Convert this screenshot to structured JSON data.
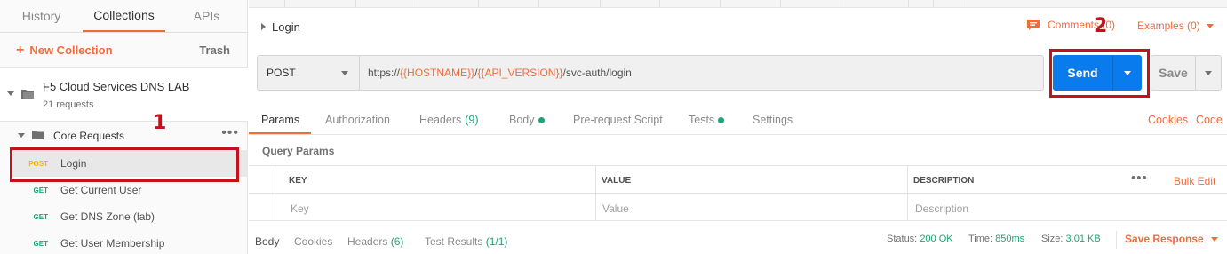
{
  "sidebar": {
    "tabs": [
      {
        "label": "History"
      },
      {
        "label": "Collections"
      },
      {
        "label": "APIs"
      }
    ],
    "new_collection": "New Collection",
    "trash": "Trash",
    "collection": {
      "title": "F5 Cloud Services DNS LAB",
      "subtitle": "21 requests"
    },
    "folder": {
      "label": "Core Requests"
    },
    "requests": [
      {
        "method": "POST",
        "name": "Login"
      },
      {
        "method": "GET",
        "name": "Get Current User"
      },
      {
        "method": "GET",
        "name": "Get DNS Zone (lab)"
      },
      {
        "method": "GET",
        "name": "Get User Membership"
      }
    ]
  },
  "annotations": {
    "one": "1",
    "two": "2"
  },
  "request": {
    "name": "Login",
    "comments": "Comments (0)",
    "examples": "Examples (0)",
    "method": "POST",
    "url": {
      "p1": "https://",
      "v1": "{{HOSTNAME}}",
      "p2": "/",
      "v2": "{{API_VERSION}}",
      "p3": "/svc-auth/login"
    },
    "send": "Send",
    "save": "Save"
  },
  "subtabs": {
    "params": "Params",
    "authorization": "Authorization",
    "headers": "Headers",
    "headers_count": "(9)",
    "body": "Body",
    "prerequest": "Pre-request Script",
    "tests": "Tests",
    "settings": "Settings",
    "cookies": "Cookies",
    "code": "Code"
  },
  "query_params": {
    "title": "Query Params",
    "columns": {
      "key": "KEY",
      "value": "VALUE",
      "description": "DESCRIPTION"
    },
    "placeholders": {
      "key": "Key",
      "value": "Value",
      "description": "Description"
    },
    "bulk_edit": "Bulk Edit"
  },
  "response": {
    "tabs": {
      "body": "Body",
      "cookies": "Cookies",
      "headers": "Headers",
      "headers_count": "(6)",
      "test_results": "Test Results",
      "test_results_count": "(1/1)"
    },
    "status_label": "Status:",
    "status": "200 OK",
    "time_label": "Time:",
    "time": "850ms",
    "size_label": "Size:",
    "size": "3.01 KB",
    "save_response": "Save Response"
  },
  "colors": {
    "accent": "#f26b3a",
    "send_blue": "#097bed",
    "success_green": "#1fa373",
    "post_yellow": "#f5b300",
    "highlight_red": "#c4121a"
  }
}
